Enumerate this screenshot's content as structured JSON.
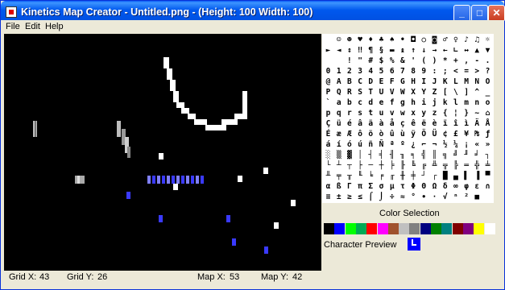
{
  "window": {
    "title": "Kinetics Map Creator - Untitled.png - (Height: 100 Width: 100)"
  },
  "title_buttons": {
    "minimize": "_",
    "maximize": "□",
    "close": "✕"
  },
  "menu": [
    "File",
    "Edit",
    "Help"
  ],
  "charset_rows": [
    [
      "",
      "☺",
      "☻",
      "♥",
      "♦",
      "♣",
      "♠",
      "•",
      "◘",
      "○",
      "◙",
      "♂",
      "♀",
      "♪",
      "♫",
      "☼"
    ],
    [
      "►",
      "◄",
      "↕",
      "‼",
      "¶",
      "§",
      "▬",
      "↨",
      "↑",
      "↓",
      "→",
      "←",
      "∟",
      "↔",
      "▲",
      "▼"
    ],
    [
      "",
      " ",
      "!",
      "\"",
      "#",
      "$",
      "%",
      "&",
      "'",
      "(",
      ")",
      "*",
      "+",
      ",",
      "-",
      ".",
      "/"
    ],
    [
      "0",
      "1",
      "2",
      "3",
      "4",
      "5",
      "6",
      "7",
      "8",
      "9",
      ":",
      ";",
      "<",
      "=",
      ">",
      "?"
    ],
    [
      "@",
      "A",
      "B",
      "C",
      "D",
      "E",
      "F",
      "G",
      "H",
      "I",
      "J",
      "K",
      "L",
      "M",
      "N",
      "O"
    ],
    [
      "P",
      "Q",
      "R",
      "S",
      "T",
      "U",
      "V",
      "W",
      "X",
      "Y",
      "Z",
      "[",
      "\\",
      "]",
      "^",
      "_"
    ],
    [
      "`",
      "a",
      "b",
      "c",
      "d",
      "e",
      "f",
      "g",
      "h",
      "i",
      "j",
      "k",
      "l",
      "m",
      "n",
      "o"
    ],
    [
      "p",
      "q",
      "r",
      "s",
      "t",
      "u",
      "v",
      "w",
      "x",
      "y",
      "z",
      "{",
      "¦",
      "}",
      "~",
      "⌂"
    ],
    [
      "Ç",
      "ü",
      "é",
      "â",
      "ä",
      "à",
      "å",
      "ç",
      "ê",
      "ë",
      "è",
      "ï",
      "î",
      "ì",
      "Ä",
      "Å"
    ],
    [
      "É",
      "æ",
      "Æ",
      "ô",
      "ö",
      "ò",
      "û",
      "ù",
      "ÿ",
      "Ö",
      "Ü",
      "¢",
      "£",
      "¥",
      "₧",
      "ƒ"
    ],
    [
      "á",
      "í",
      "ó",
      "ú",
      "ñ",
      "Ñ",
      "ª",
      "º",
      "¿",
      "⌐",
      "¬",
      "½",
      "¼",
      "¡",
      "«",
      "»"
    ],
    [
      "░",
      "▒",
      "▓",
      "│",
      "┤",
      "╡",
      "╢",
      "╖",
      "╕",
      "╣",
      "║",
      "╗",
      "╝",
      "╜",
      "╛",
      "┐"
    ],
    [
      "└",
      "┴",
      "┬",
      "├",
      "─",
      "┼",
      "╞",
      "╟",
      "╚",
      "╔",
      "╩",
      "╦",
      "╠",
      "═",
      "╬",
      "╧"
    ],
    [
      "╨",
      "╤",
      "╥",
      "╙",
      "╘",
      "╒",
      "╓",
      "╫",
      "╪",
      "┘",
      "┌",
      "█",
      "▄",
      "▌",
      "▐",
      "▀"
    ],
    [
      "α",
      "ß",
      "Γ",
      "π",
      "Σ",
      "σ",
      "µ",
      "τ",
      "Φ",
      "Θ",
      "Ω",
      "δ",
      "∞",
      "φ",
      "ε",
      "∩"
    ],
    [
      "≡",
      "±",
      "≥",
      "≤",
      "⌠",
      "⌡",
      "÷",
      "≈",
      "°",
      "∙",
      "·",
      "√",
      "ⁿ",
      "²",
      "■",
      ""
    ]
  ],
  "color_selection": {
    "label": "Color Selection",
    "colors": [
      "#000000",
      "#0000ff",
      "#00ff00",
      "#00aa55",
      "#ff0000",
      "#ff00ff",
      "#a0522d",
      "#c0c0c0",
      "#808080",
      "#000080",
      "#008000",
      "#008080",
      "#800000",
      "#800080",
      "#ffff00",
      "#ffffff"
    ]
  },
  "character_preview": {
    "label": "Character Preview",
    "color": "#0000ff"
  },
  "status": {
    "grid_x_label": "Grid X:",
    "grid_x": "43",
    "grid_y_label": "Grid Y:",
    "grid_y": "26",
    "map_x_label": "Map X:",
    "map_x": "53",
    "map_y_label": "Map Y:",
    "map_y": "42"
  }
}
